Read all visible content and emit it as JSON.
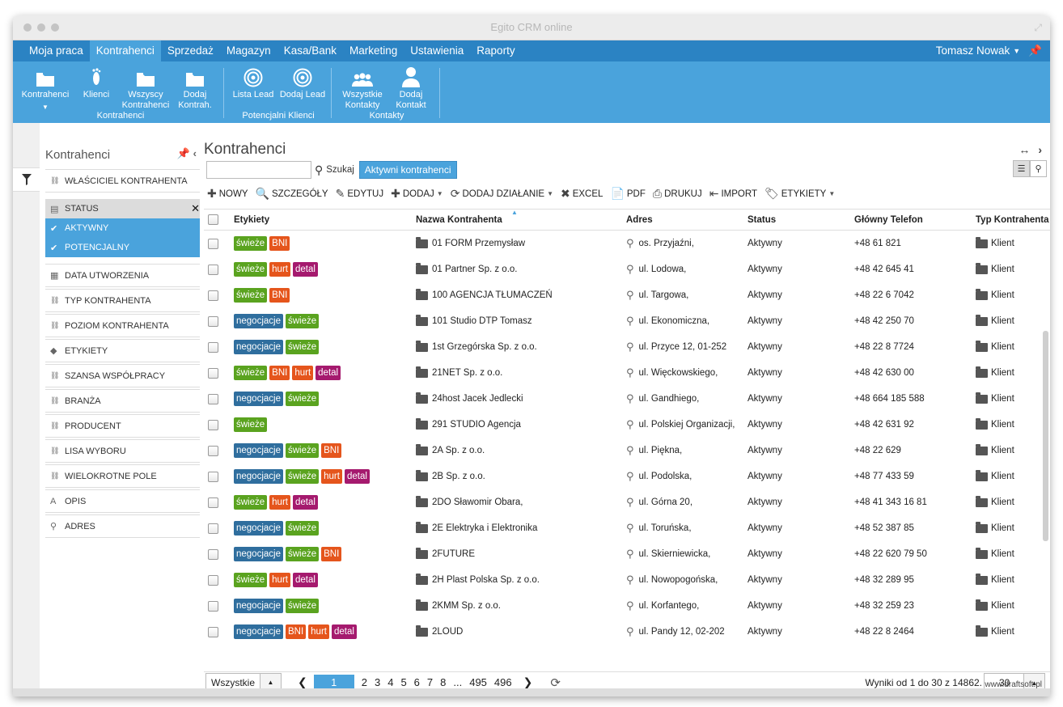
{
  "window": {
    "title": "Egito CRM online"
  },
  "nav": {
    "items": [
      {
        "label": "Moja praca",
        "active": false
      },
      {
        "label": "Kontrahenci",
        "active": true
      },
      {
        "label": "Sprzedaż",
        "active": false
      },
      {
        "label": "Magazyn",
        "active": false
      },
      {
        "label": "Kasa/Bank",
        "active": false
      },
      {
        "label": "Marketing",
        "active": false
      },
      {
        "label": "Ustawienia",
        "active": false
      },
      {
        "label": "Raporty",
        "active": false
      }
    ],
    "user": "Tomasz Nowak"
  },
  "ribbon": {
    "buttons": [
      {
        "label": "Kontrahenci",
        "icon": "folder-icon"
      },
      {
        "label": "Klienci",
        "icon": "footprint-icon"
      },
      {
        "label": "Wszyscy Kontrahenci",
        "icon": "folder-icon"
      },
      {
        "label": "Dodaj Kontrah.",
        "icon": "folder-icon"
      },
      {
        "label": "Lista Lead",
        "icon": "target-icon"
      },
      {
        "label": "Dodaj Lead",
        "icon": "target-icon"
      },
      {
        "label": "Wszystkie Kontakty",
        "icon": "people-icon"
      },
      {
        "label": "Dodaj Kontakt",
        "icon": "person-icon"
      }
    ],
    "groups": [
      "Kontrahenci",
      "Potencjalni Klienci",
      "Kontakty"
    ]
  },
  "panel": {
    "title": "Kontrahenci",
    "filters": [
      {
        "label": "WŁAŚCICIEL KONTRAHENTA",
        "icon": "link-icon",
        "kind": "normal"
      },
      {
        "label": "STATUS",
        "icon": "list-icon",
        "kind": "status"
      },
      {
        "label": "AKTYWNY",
        "icon": "check-icon",
        "kind": "sel"
      },
      {
        "label": "POTENCJALNY",
        "icon": "check-icon",
        "kind": "sel"
      },
      {
        "label": "DATA UTWORZENIA",
        "icon": "calendar-icon",
        "kind": "normal"
      },
      {
        "label": "TYP KONTRAHENTA",
        "icon": "link-icon",
        "kind": "normal"
      },
      {
        "label": "POZIOM KONTRAHENTA",
        "icon": "link-icon",
        "kind": "normal"
      },
      {
        "label": "ETYKIETY",
        "icon": "tag-icon",
        "kind": "normal"
      },
      {
        "label": "SZANSA WSPÓŁPRACY",
        "icon": "link-icon",
        "kind": "normal"
      },
      {
        "label": "BRANŻA",
        "icon": "link-icon",
        "kind": "normal"
      },
      {
        "label": "PRODUCENT",
        "icon": "link-icon",
        "kind": "normal"
      },
      {
        "label": "LISA WYBORU",
        "icon": "link-icon",
        "kind": "normal"
      },
      {
        "label": "WIELOKROTNE POLE",
        "icon": "link-icon",
        "kind": "normal"
      },
      {
        "label": "OPIS",
        "icon": "text-icon",
        "kind": "normal"
      },
      {
        "label": "ADRES",
        "icon": "map-pin-icon",
        "kind": "normal"
      }
    ]
  },
  "main": {
    "title": "Kontrahenci",
    "search": {
      "value": "",
      "placeholder": "",
      "button": "Szukaj",
      "chip": "Aktywni kontrahenci"
    },
    "toolbar": [
      {
        "label": "NOWY",
        "icon": "plus-icon",
        "caret": false
      },
      {
        "label": "SZCZEGÓŁY",
        "icon": "details-icon",
        "caret": false
      },
      {
        "label": "EDYTUJ",
        "icon": "pencil-icon",
        "caret": false
      },
      {
        "label": "DODAJ",
        "icon": "plus-icon",
        "caret": true
      },
      {
        "label": "DODAJ DZIAŁANIE",
        "icon": "refresh-icon",
        "caret": true
      },
      {
        "label": "EXCEL",
        "icon": "excel-icon",
        "caret": false
      },
      {
        "label": "PDF",
        "icon": "pdf-icon",
        "caret": false
      },
      {
        "label": "DRUKUJ",
        "icon": "print-icon",
        "caret": false
      },
      {
        "label": "IMPORT",
        "icon": "import-icon",
        "caret": false
      },
      {
        "label": "ETYKIETY",
        "icon": "tag-icon",
        "caret": true
      }
    ]
  },
  "table": {
    "columns": [
      "Etykiety",
      "Nazwa Kontrahenta",
      "Adres",
      "Status",
      "Główny Telefon",
      "Typ Kontrahenta"
    ],
    "rows": [
      {
        "tags": [
          "świeże",
          "BNI"
        ],
        "name": "01 FORM Przemysław",
        "addr": "os. Przyjaźni,",
        "status": "Aktywny",
        "tel": "+48 61 821",
        "type": "Klient"
      },
      {
        "tags": [
          "świeże",
          "hurt",
          "detal"
        ],
        "name": "01 Partner Sp. z o.o.",
        "addr": "ul. Lodowa,",
        "status": "Aktywny",
        "tel": "+48 42 645 41",
        "type": "Klient"
      },
      {
        "tags": [
          "świeże",
          "BNI"
        ],
        "name": "100 AGENCJA TŁUMACZEŃ",
        "addr": "ul. Targowa,",
        "status": "Aktywny",
        "tel": "+48 22 6 7042",
        "type": "Klient"
      },
      {
        "tags": [
          "negocjacje",
          "świeże"
        ],
        "name": "101 Studio DTP Tomasz",
        "addr": "ul. Ekonomiczna,",
        "status": "Aktywny",
        "tel": "+48 42 250 70",
        "type": "Klient"
      },
      {
        "tags": [
          "negocjacje",
          "świeże"
        ],
        "name": "1st Grzegórska Sp. z o.o.",
        "addr": "ul. Przyce 12, 01-252",
        "status": "Aktywny",
        "tel": "+48 22 8 7724",
        "type": "Klient"
      },
      {
        "tags": [
          "świeże",
          "BNI",
          "hurt",
          "detal"
        ],
        "name": "21NET Sp. z o.o.",
        "addr": "ul. Więckowskiego,",
        "status": "Aktywny",
        "tel": "+48 42 630 00",
        "type": "Klient"
      },
      {
        "tags": [
          "negocjacje",
          "świeże"
        ],
        "name": "24host Jacek Jedlecki",
        "addr": "ul. Gandhiego,",
        "status": "Aktywny",
        "tel": "+48 664 185 588",
        "type": "Klient"
      },
      {
        "tags": [
          "świeże"
        ],
        "name": "291 STUDIO Agencja",
        "addr": "ul. Polskiej Organizacji,",
        "status": "Aktywny",
        "tel": "+48 42 631 92",
        "type": "Klient"
      },
      {
        "tags": [
          "negocjacje",
          "świeże",
          "BNI"
        ],
        "name": "2A Sp. z o.o.",
        "addr": "ul. Piękna,",
        "status": "Aktywny",
        "tel": "+48 22 629",
        "type": "Klient"
      },
      {
        "tags": [
          "negocjacje",
          "świeże",
          "hurt",
          "detal"
        ],
        "name": "2B Sp. z o.o.",
        "addr": "ul. Podolska,",
        "status": "Aktywny",
        "tel": "+48 77 433 59",
        "type": "Klient"
      },
      {
        "tags": [
          "świeże",
          "hurt",
          "detal"
        ],
        "name": "2DO Sławomir Obara,",
        "addr": "ul. Górna 20,",
        "status": "Aktywny",
        "tel": "+48 41 343 16 81",
        "type": "Klient"
      },
      {
        "tags": [
          "negocjacje",
          "świeże"
        ],
        "name": "2E Elektryka i Elektronika",
        "addr": "ul. Toruńska,",
        "status": "Aktywny",
        "tel": "+48 52 387 85",
        "type": "Klient"
      },
      {
        "tags": [
          "negocjacje",
          "świeże",
          "BNI"
        ],
        "name": "2FUTURE",
        "addr": "ul. Skierniewicka,",
        "status": "Aktywny",
        "tel": "+48 22 620 79 50",
        "type": "Klient"
      },
      {
        "tags": [
          "świeże",
          "hurt",
          "detal"
        ],
        "name": "2H Plast Polska Sp. z o.o.",
        "addr": "ul. Nowopogońska,",
        "status": "Aktywny",
        "tel": "+48 32 289 95",
        "type": "Klient"
      },
      {
        "tags": [
          "negocjacje",
          "świeże"
        ],
        "name": "2KMM Sp. z o.o.",
        "addr": "ul. Korfantego,",
        "status": "Aktywny",
        "tel": "+48 32 259 23",
        "type": "Klient"
      },
      {
        "tags": [
          "negocjacje",
          "BNI",
          "hurt",
          "detal"
        ],
        "name": "2LOUD",
        "addr": "ul. Pandy 12, 02-202",
        "status": "Aktywny",
        "tel": "+48 22 8 2464",
        "type": "Klient"
      }
    ]
  },
  "tag_colors": {
    "świeże": "#5aa31f",
    "BNI": "#e5551c",
    "hurt": "#e5551c",
    "detal": "#a51a6e",
    "negocjacje": "#2f6e9e"
  },
  "pager": {
    "all": "Wszystkie",
    "current": "1",
    "pages": [
      "2",
      "3",
      "4",
      "5",
      "6",
      "7",
      "8",
      "...",
      "495",
      "496"
    ],
    "info": "Wyniki od 1 do 30 z 14862.",
    "pageSize": "30"
  },
  "credit": "www.draftsoft.pl"
}
